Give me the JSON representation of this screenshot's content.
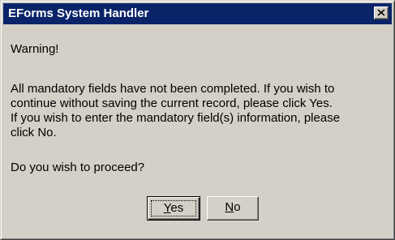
{
  "window": {
    "title": "EForms System Handler"
  },
  "content": {
    "heading": "Warning!",
    "message_lines": [
      "All mandatory fields have not been completed.  If you wish to",
      "continue without saving the current record, please click Yes.",
      "If you wish to enter the mandatory field(s) information, please",
      "click No."
    ],
    "question": "Do you wish to proceed?"
  },
  "buttons": {
    "yes": {
      "accel": "Y",
      "rest": "es"
    },
    "no": {
      "accel": "N",
      "rest": "o"
    }
  },
  "icons": {
    "close": "close-icon"
  },
  "colors": {
    "titlebar": "#0a246a",
    "face": "#d4d0c8"
  }
}
